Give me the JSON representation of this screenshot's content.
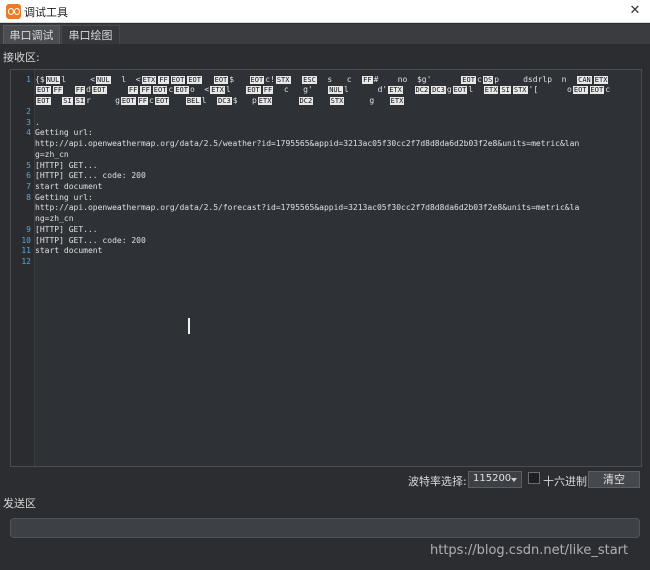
{
  "window": {
    "title": "调试工具",
    "close_glyph": "✕"
  },
  "tabs": [
    "串口调试",
    "串口绘图"
  ],
  "receive": {
    "label": "接收区:",
    "line_numbers": [
      "1",
      "2",
      "3",
      "4",
      "5",
      "6",
      "7",
      "8",
      "9",
      "10",
      "11",
      "12"
    ],
    "binary_rows": [
      [
        {
          "t": "{$"
        },
        {
          "k": "NUL"
        },
        {
          "t": "l     <"
        },
        {
          "k": "NUL"
        },
        {
          "t": "  l  <"
        },
        {
          "k": "ETX"
        },
        {
          "k": "FF"
        },
        {
          "k": "EOT"
        },
        {
          "k": "EOT"
        },
        {
          "t": "  "
        },
        {
          "k": "EOT"
        },
        {
          "t": "$   "
        },
        {
          "k": "EOT"
        },
        {
          "t": "c!"
        },
        {
          "k": "STX"
        },
        {
          "t": "  "
        },
        {
          "k": "ESC"
        },
        {
          "t": "  s   c  "
        },
        {
          "k": "FF"
        },
        {
          "t": "#    no  $g'      "
        },
        {
          "k": "EOT"
        },
        {
          "t": "c"
        },
        {
          "k": "DS"
        },
        {
          "t": "p     dsdrlp  n  "
        },
        {
          "k": "CAN"
        },
        {
          "k": "ETX"
        }
      ],
      [
        {
          "k": "EOT"
        },
        {
          "k": "FF"
        },
        {
          "t": "  "
        },
        {
          "k": "FF"
        },
        {
          "t": "d"
        },
        {
          "k": "EOT"
        },
        {
          "t": "    "
        },
        {
          "k": "FF"
        },
        {
          "k": "FF"
        },
        {
          "k": "EOT"
        },
        {
          "t": "c"
        },
        {
          "k": "EOT"
        },
        {
          "t": "o  <"
        },
        {
          "k": "ETX"
        },
        {
          "t": "l   "
        },
        {
          "k": "EOT"
        },
        {
          "k": "FF"
        },
        {
          "t": "  c   g'   "
        },
        {
          "k": "NUL"
        },
        {
          "t": "l      d'"
        },
        {
          "k": "ETX"
        },
        {
          "t": "  "
        },
        {
          "k": "DC2"
        },
        {
          "k": "DC3"
        },
        {
          "t": "g"
        },
        {
          "k": "EOT"
        },
        {
          "t": "l  "
        },
        {
          "k": "ETX"
        },
        {
          "k": "SI"
        },
        {
          "k": "STX"
        },
        {
          "t": "'[      o"
        },
        {
          "k": "EOT"
        },
        {
          "k": "EOT"
        },
        {
          "t": "c"
        }
      ],
      [
        {
          "k": "EOT"
        },
        {
          "t": "  "
        },
        {
          "k": "SI"
        },
        {
          "k": "SI"
        },
        {
          "t": "r     g"
        },
        {
          "k": "EOT"
        },
        {
          "k": "FF"
        },
        {
          "t": "c"
        },
        {
          "k": "EOT"
        },
        {
          "t": "   "
        },
        {
          "k": "BEL"
        },
        {
          "t": "l  "
        },
        {
          "k": "DC3"
        },
        {
          "t": "$   p"
        },
        {
          "k": "ETX"
        },
        {
          "t": "     "
        },
        {
          "k": "DC2"
        },
        {
          "t": "   "
        },
        {
          "k": "STX"
        },
        {
          "t": "     g   "
        },
        {
          "k": "ETX"
        }
      ]
    ],
    "text_lines": {
      "l3": ".",
      "l4": "Getting url:",
      "l4b": "http://api.openweathermap.org/data/2.5/weather?id=1795565&appid=3213ac05f30cc2f7d8d8da6d2b03f2e8&units=metric&lan",
      "l4c": "g=zh_cn",
      "l5": "[HTTP] GET...",
      "l6": "[HTTP] GET... code: 200",
      "l7": "start document",
      "l8": "Getting url:",
      "l8b": "http://api.openweathermap.org/data/2.5/forecast?id=1795565&appid=3213ac05f30cc2f7d8d8da6d2b03f2e8&units=metric&la",
      "l8c": "ng=zh_cn",
      "l9": "[HTTP] GET...",
      "l10": "[HTTP] GET... code: 200",
      "l11": "start document"
    }
  },
  "controls": {
    "baud_label": "波特率选择:",
    "baud_value": "115200",
    "hex_label": "十六进制",
    "clear_label": "清空"
  },
  "send": {
    "label": "发送区",
    "value": ""
  },
  "overlay": {
    "watermark": "https://blog.csdn.net/like_start"
  },
  "colors": {
    "line_number": "#58a7d8",
    "editor_bg": "#2e3136",
    "panel_bg": "#2b2d30"
  }
}
